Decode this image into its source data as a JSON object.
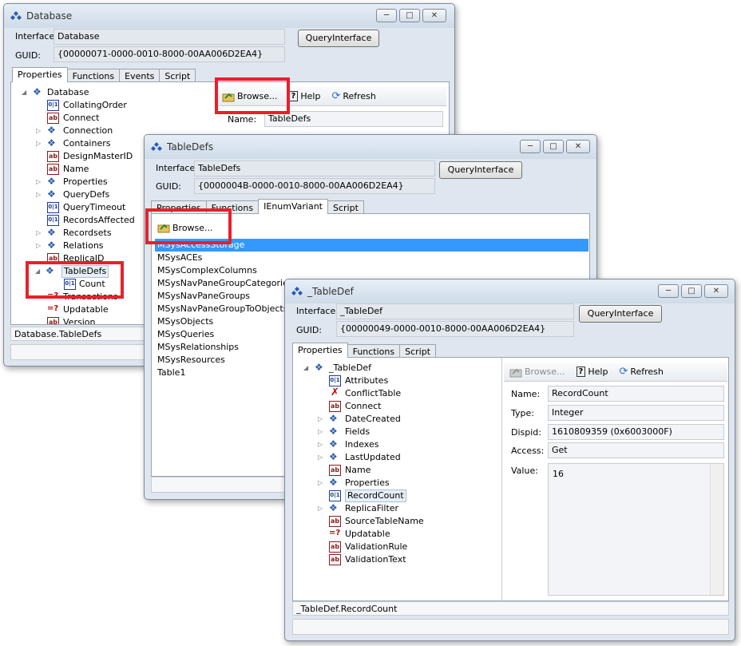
{
  "win1": {
    "title": "Database",
    "interface_label": "Interface:",
    "interface_value": "Database",
    "guid_label": "GUID:",
    "guid_value": "{00000071-0000-0010-8000-00AA006D2EA4}",
    "query_button": "QueryInterface",
    "tabs": [
      "Properties",
      "Functions",
      "Events",
      "Script"
    ],
    "tree_root": "Database",
    "tree": [
      {
        "label": "CollatingOrder",
        "icon": "number-icon",
        "exp": false
      },
      {
        "label": "Connect",
        "icon": "text-icon",
        "exp": false
      },
      {
        "label": "Connection",
        "icon": "object-icon",
        "exp": true
      },
      {
        "label": "Containers",
        "icon": "object-icon",
        "exp": true
      },
      {
        "label": "DesignMasterID",
        "icon": "text-icon",
        "exp": false
      },
      {
        "label": "Name",
        "icon": "text-icon",
        "exp": false
      },
      {
        "label": "Properties",
        "icon": "object-icon",
        "exp": true
      },
      {
        "label": "QueryDefs",
        "icon": "object-icon",
        "exp": true
      },
      {
        "label": "QueryTimeout",
        "icon": "number-icon",
        "exp": false
      },
      {
        "label": "RecordsAffected",
        "icon": "number-icon",
        "exp": false
      },
      {
        "label": "Recordsets",
        "icon": "object-icon",
        "exp": true
      },
      {
        "label": "Relations",
        "icon": "object-icon",
        "exp": true
      },
      {
        "label": "ReplicaID",
        "icon": "text-icon",
        "exp": false
      }
    ],
    "tabledefs": "TableDefs",
    "count": "Count",
    "tree_after": [
      {
        "label": "Transactions",
        "icon": "bool-icon"
      },
      {
        "label": "Updatable",
        "icon": "bool-icon"
      },
      {
        "label": "Version",
        "icon": "text-icon"
      }
    ],
    "browse": "Browse...",
    "help": "Help",
    "refresh": "Refresh",
    "name_label": "Name:",
    "name_value": "TableDefs",
    "status": "Database.TableDefs"
  },
  "win2": {
    "title": "TableDefs",
    "interface_label": "Interface:",
    "interface_value": "TableDefs",
    "guid_label": "GUID:",
    "guid_value": "{0000004B-0000-0010-8000-00AA006D2EA4}",
    "query_button": "QueryInterface",
    "tabs": [
      "Properties",
      "Functions",
      "IEnumVariant",
      "Script"
    ],
    "browse": "Browse...",
    "items": [
      "MSysAccessStorage",
      "MSysACEs",
      "MSysComplexColumns",
      "MSysNavPaneGroupCategories",
      "MSysNavPaneGroups",
      "MSysNavPaneGroupToObjects",
      "MSysObjects",
      "MSysQueries",
      "MSysRelationships",
      "MSysResources",
      "Table1"
    ]
  },
  "win3": {
    "title": "_TableDef",
    "interface_label": "Interface:",
    "interface_value": "_TableDef",
    "guid_label": "GUID:",
    "guid_value": "{00000049-0000-0010-8000-00AA006D2EA4}",
    "query_button": "QueryInterface",
    "tabs": [
      "Properties",
      "Functions",
      "Script"
    ],
    "tree_root": "_TableDef",
    "tree": [
      {
        "label": "Attributes",
        "icon": "number-icon",
        "exp": false
      },
      {
        "label": "ConflictTable",
        "icon": "error-icon",
        "exp": false
      },
      {
        "label": "Connect",
        "icon": "text-icon",
        "exp": false
      },
      {
        "label": "DateCreated",
        "icon": "object-icon",
        "exp": true
      },
      {
        "label": "Fields",
        "icon": "object-icon",
        "exp": true
      },
      {
        "label": "Indexes",
        "icon": "object-icon",
        "exp": true
      },
      {
        "label": "LastUpdated",
        "icon": "object-icon",
        "exp": true
      },
      {
        "label": "Name",
        "icon": "text-icon",
        "exp": false
      },
      {
        "label": "Properties",
        "icon": "object-icon",
        "exp": true
      },
      {
        "label": "RecordCount",
        "icon": "number-icon",
        "exp": false,
        "selected": true
      },
      {
        "label": "ReplicaFilter",
        "icon": "object-icon",
        "exp": true
      },
      {
        "label": "SourceTableName",
        "icon": "text-icon",
        "exp": false
      },
      {
        "label": "Updatable",
        "icon": "bool-icon",
        "exp": false
      },
      {
        "label": "ValidationRule",
        "icon": "text-icon",
        "exp": false
      },
      {
        "label": "ValidationText",
        "icon": "text-icon",
        "exp": false
      }
    ],
    "browse": "Browse...",
    "help": "Help",
    "refresh": "Refresh",
    "props": {
      "name_label": "Name:",
      "name_value": "RecordCount",
      "type_label": "Type:",
      "type_value": "Integer",
      "dispid_label": "Dispid:",
      "dispid_value": "1610809359   (0x6003000F)",
      "access_label": "Access:",
      "access_value": "Get",
      "value_label": "Value:",
      "value_value": "16"
    },
    "status": "_TableDef.RecordCount"
  },
  "icons": {
    "minimize": "─",
    "maximize": "□",
    "close": "✕"
  }
}
